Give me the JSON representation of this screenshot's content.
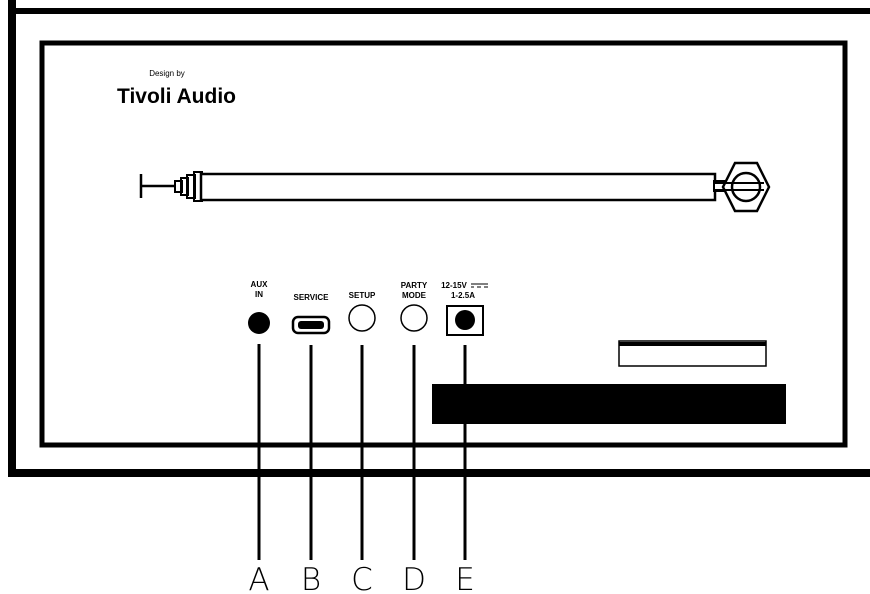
{
  "brand": {
    "tagline": "Design by",
    "name": "Tivoli Audio"
  },
  "ports": [
    {
      "id": "A",
      "label_line1": "AUX",
      "label_line2": "IN",
      "type": "filled-circle"
    },
    {
      "id": "B",
      "label_line1": "SERVICE",
      "label_line2": "",
      "type": "usb-slot"
    },
    {
      "id": "C",
      "label_line1": "SETUP",
      "label_line2": "",
      "type": "hollow-circle"
    },
    {
      "id": "D",
      "label_line1": "PARTY",
      "label_line2": "MODE",
      "type": "hollow-circle"
    },
    {
      "id": "E",
      "label_line1": "12-15V",
      "label_line2": "1-2.5A",
      "type": "dc-jack"
    }
  ],
  "callouts": [
    "A",
    "B",
    "C",
    "D",
    "E"
  ],
  "colors": {
    "ink": "#000000",
    "background": "#ffffff"
  }
}
